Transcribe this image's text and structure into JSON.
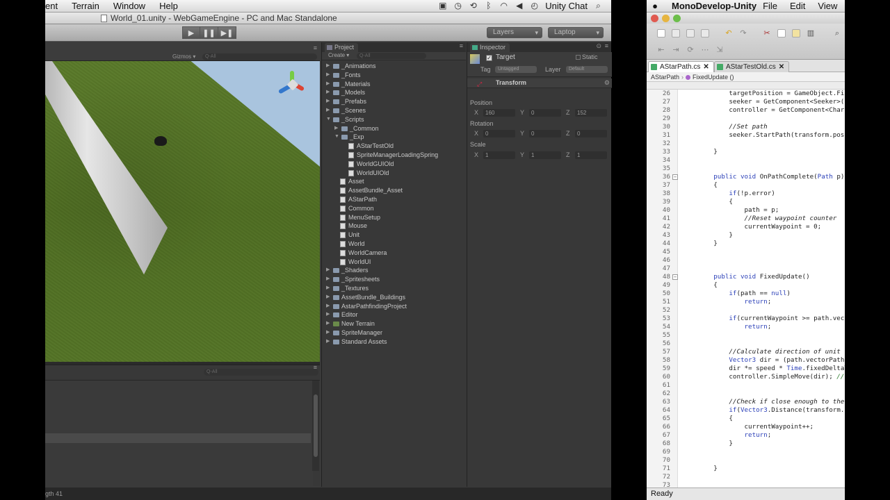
{
  "unity_menubar": {
    "items": [
      "ent",
      "Terrain",
      "Window",
      "Help"
    ],
    "status_icons": [
      "camera-icon",
      "clock-icon",
      "time-machine-icon",
      "bluetooth-icon",
      "wifi-icon",
      "volume-icon",
      "chat-status-icon",
      "search-icon"
    ],
    "app_name": "Unity Chat"
  },
  "unity_window": {
    "title": "World_01.unity - WebGameEngine - PC and Mac Standalone",
    "layers_label": "Layers",
    "layout_label": "Laptop"
  },
  "scene": {
    "gizmos_label": "Gizmos ▾",
    "search_placeholder": "Q‑All"
  },
  "lower_panel": {
    "search_placeholder": "Q‑All"
  },
  "status_line": "gth 41",
  "project": {
    "tab_label": "Project",
    "create_label": "Create ▾",
    "search_placeholder": "Q‑All",
    "tree": [
      {
        "label": "_Animations",
        "depth": 0,
        "type": "folder",
        "arrow": "▶"
      },
      {
        "label": "_Fonts",
        "depth": 0,
        "type": "folder",
        "arrow": "▶"
      },
      {
        "label": "_Materials",
        "depth": 0,
        "type": "folder",
        "arrow": "▶"
      },
      {
        "label": "_Models",
        "depth": 0,
        "type": "folder",
        "arrow": "▶"
      },
      {
        "label": "_Prefabs",
        "depth": 0,
        "type": "folder",
        "arrow": "▶"
      },
      {
        "label": "_Scenes",
        "depth": 0,
        "type": "folder",
        "arrow": "▶"
      },
      {
        "label": "_Scripts",
        "depth": 0,
        "type": "folder",
        "arrow": "▼"
      },
      {
        "label": "_Common",
        "depth": 1,
        "type": "folder",
        "arrow": "▶"
      },
      {
        "label": "_Exp",
        "depth": 1,
        "type": "folder",
        "arrow": "▼"
      },
      {
        "label": "AStarTestOld",
        "depth": 2,
        "type": "script",
        "arrow": ""
      },
      {
        "label": "SpriteManagerLoadingSpring",
        "depth": 2,
        "type": "script",
        "arrow": ""
      },
      {
        "label": "WorldGUIOld",
        "depth": 2,
        "type": "script",
        "arrow": ""
      },
      {
        "label": "WorldUIOld",
        "depth": 2,
        "type": "script",
        "arrow": ""
      },
      {
        "label": "Asset",
        "depth": 1,
        "type": "script",
        "arrow": ""
      },
      {
        "label": "AssetBundle_Asset",
        "depth": 1,
        "type": "script",
        "arrow": ""
      },
      {
        "label": "AStarPath",
        "depth": 1,
        "type": "script",
        "arrow": ""
      },
      {
        "label": "Common",
        "depth": 1,
        "type": "script",
        "arrow": ""
      },
      {
        "label": "MenuSetup",
        "depth": 1,
        "type": "script",
        "arrow": ""
      },
      {
        "label": "Mouse",
        "depth": 1,
        "type": "script",
        "arrow": ""
      },
      {
        "label": "Unit",
        "depth": 1,
        "type": "script",
        "arrow": ""
      },
      {
        "label": "World",
        "depth": 1,
        "type": "script",
        "arrow": ""
      },
      {
        "label": "WorldCamera",
        "depth": 1,
        "type": "script",
        "arrow": ""
      },
      {
        "label": "WorldUI",
        "depth": 1,
        "type": "script",
        "arrow": ""
      },
      {
        "label": "_Shaders",
        "depth": 0,
        "type": "folder",
        "arrow": "▶"
      },
      {
        "label": "_Spritesheets",
        "depth": 0,
        "type": "folder",
        "arrow": "▶"
      },
      {
        "label": "_Textures",
        "depth": 0,
        "type": "folder",
        "arrow": "▶"
      },
      {
        "label": "AssetBundle_Buildings",
        "depth": 0,
        "type": "folder",
        "arrow": "▶"
      },
      {
        "label": "AstarPathfindingProject",
        "depth": 0,
        "type": "folder",
        "arrow": "▶"
      },
      {
        "label": "Editor",
        "depth": 0,
        "type": "folder",
        "arrow": "▶"
      },
      {
        "label": "New Terrain",
        "depth": 0,
        "type": "terrain",
        "arrow": "▶"
      },
      {
        "label": "SpriteManager",
        "depth": 0,
        "type": "folder",
        "arrow": "▶"
      },
      {
        "label": "Standard Assets",
        "depth": 0,
        "type": "folder",
        "arrow": "▶"
      }
    ]
  },
  "inspector": {
    "tab_label": "Inspector",
    "object_name": "Target",
    "static_label": "Static",
    "tag_label": "Tag",
    "tag_value": "Untagged",
    "layer_label": "Layer",
    "layer_value": "Default",
    "component_label": "Transform",
    "position_label": "Position",
    "position": {
      "x": "160",
      "y": "0",
      "z": "152"
    },
    "rotation_label": "Rotation",
    "rotation": {
      "x": "0",
      "y": "0",
      "z": "0"
    },
    "scale_label": "Scale",
    "scale": {
      "x": "1",
      "y": "1",
      "z": "1"
    },
    "axis_x": "X",
    "axis_y": "Y",
    "axis_z": "Z"
  },
  "mono_menubar": {
    "app_name": "MonoDevelop-Unity",
    "items": [
      "File",
      "Edit",
      "View"
    ]
  },
  "mono": {
    "tabs": [
      {
        "label": "AStarPath.cs",
        "active": true
      },
      {
        "label": "AStarTestOld.cs",
        "active": false
      }
    ],
    "breadcrumb_class": "AStarPath",
    "breadcrumb_method": "FixedUpdate ()",
    "status": "Ready",
    "code": [
      {
        "n": "26",
        "t": "            targetPosition = GameObject.Find"
      },
      {
        "n": "27",
        "t": "            seeker = GetComponent<Seeker>();"
      },
      {
        "n": "28",
        "t": "            controller = GetComponent<Charact"
      },
      {
        "n": "29",
        "t": ""
      },
      {
        "n": "30",
        "t": "            //Set path",
        "c": true
      },
      {
        "n": "31",
        "t": "            seeker.StartPath(transform.positi"
      },
      {
        "n": "32",
        "t": ""
      },
      {
        "n": "33",
        "t": "        }"
      },
      {
        "n": "34",
        "t": ""
      },
      {
        "n": "35",
        "t": ""
      },
      {
        "n": "36",
        "t": "        public void OnPathComplete(Path p)",
        "fold": true
      },
      {
        "n": "37",
        "t": "        {"
      },
      {
        "n": "38",
        "t": "            if(!p.error)"
      },
      {
        "n": "39",
        "t": "            {"
      },
      {
        "n": "40",
        "t": "                path = p;"
      },
      {
        "n": "41",
        "t": "                //Reset waypoint counter",
        "c": true
      },
      {
        "n": "42",
        "t": "                currentWaypoint = 0;"
      },
      {
        "n": "43",
        "t": "            }"
      },
      {
        "n": "44",
        "t": "        }"
      },
      {
        "n": "45",
        "t": ""
      },
      {
        "n": "46",
        "t": ""
      },
      {
        "n": "47",
        "t": ""
      },
      {
        "n": "48",
        "t": "        public void FixedUpdate()",
        "fold": true
      },
      {
        "n": "49",
        "t": "        {"
      },
      {
        "n": "50",
        "t": "            if(path == null)"
      },
      {
        "n": "51",
        "t": "                return;"
      },
      {
        "n": "52",
        "t": ""
      },
      {
        "n": "53",
        "t": "            if(currentWaypoint >= path.vector"
      },
      {
        "n": "54",
        "t": "                return;"
      },
      {
        "n": "55",
        "t": ""
      },
      {
        "n": "56",
        "t": ""
      },
      {
        "n": "57",
        "t": "            //Calculate direction of unit",
        "c": true
      },
      {
        "n": "58",
        "t": "            Vector3 dir = (path.vectorPath[cu"
      },
      {
        "n": "59",
        "t": "            dir *= speed * Time.fixedDeltaTim"
      },
      {
        "n": "60",
        "t": "            controller.SimpleMove(dir); // Un"
      },
      {
        "n": "61",
        "t": ""
      },
      {
        "n": "62",
        "t": ""
      },
      {
        "n": "63",
        "t": "            //Check if close enough to the cu",
        "c": true
      },
      {
        "n": "64",
        "t": "            if(Vector3.Distance(transform.pos"
      },
      {
        "n": "65",
        "t": "            {"
      },
      {
        "n": "66",
        "t": "                currentWaypoint++;"
      },
      {
        "n": "67",
        "t": "                return;"
      },
      {
        "n": "68",
        "t": "            }"
      },
      {
        "n": "69",
        "t": ""
      },
      {
        "n": "70",
        "t": ""
      },
      {
        "n": "71",
        "t": "        }"
      },
      {
        "n": "72",
        "t": ""
      },
      {
        "n": "73",
        "t": ""
      }
    ]
  },
  "colors": {
    "unity_dark": "#383838",
    "code_keyword": "#2a3fb8",
    "code_comment": "#2a7a2a"
  }
}
